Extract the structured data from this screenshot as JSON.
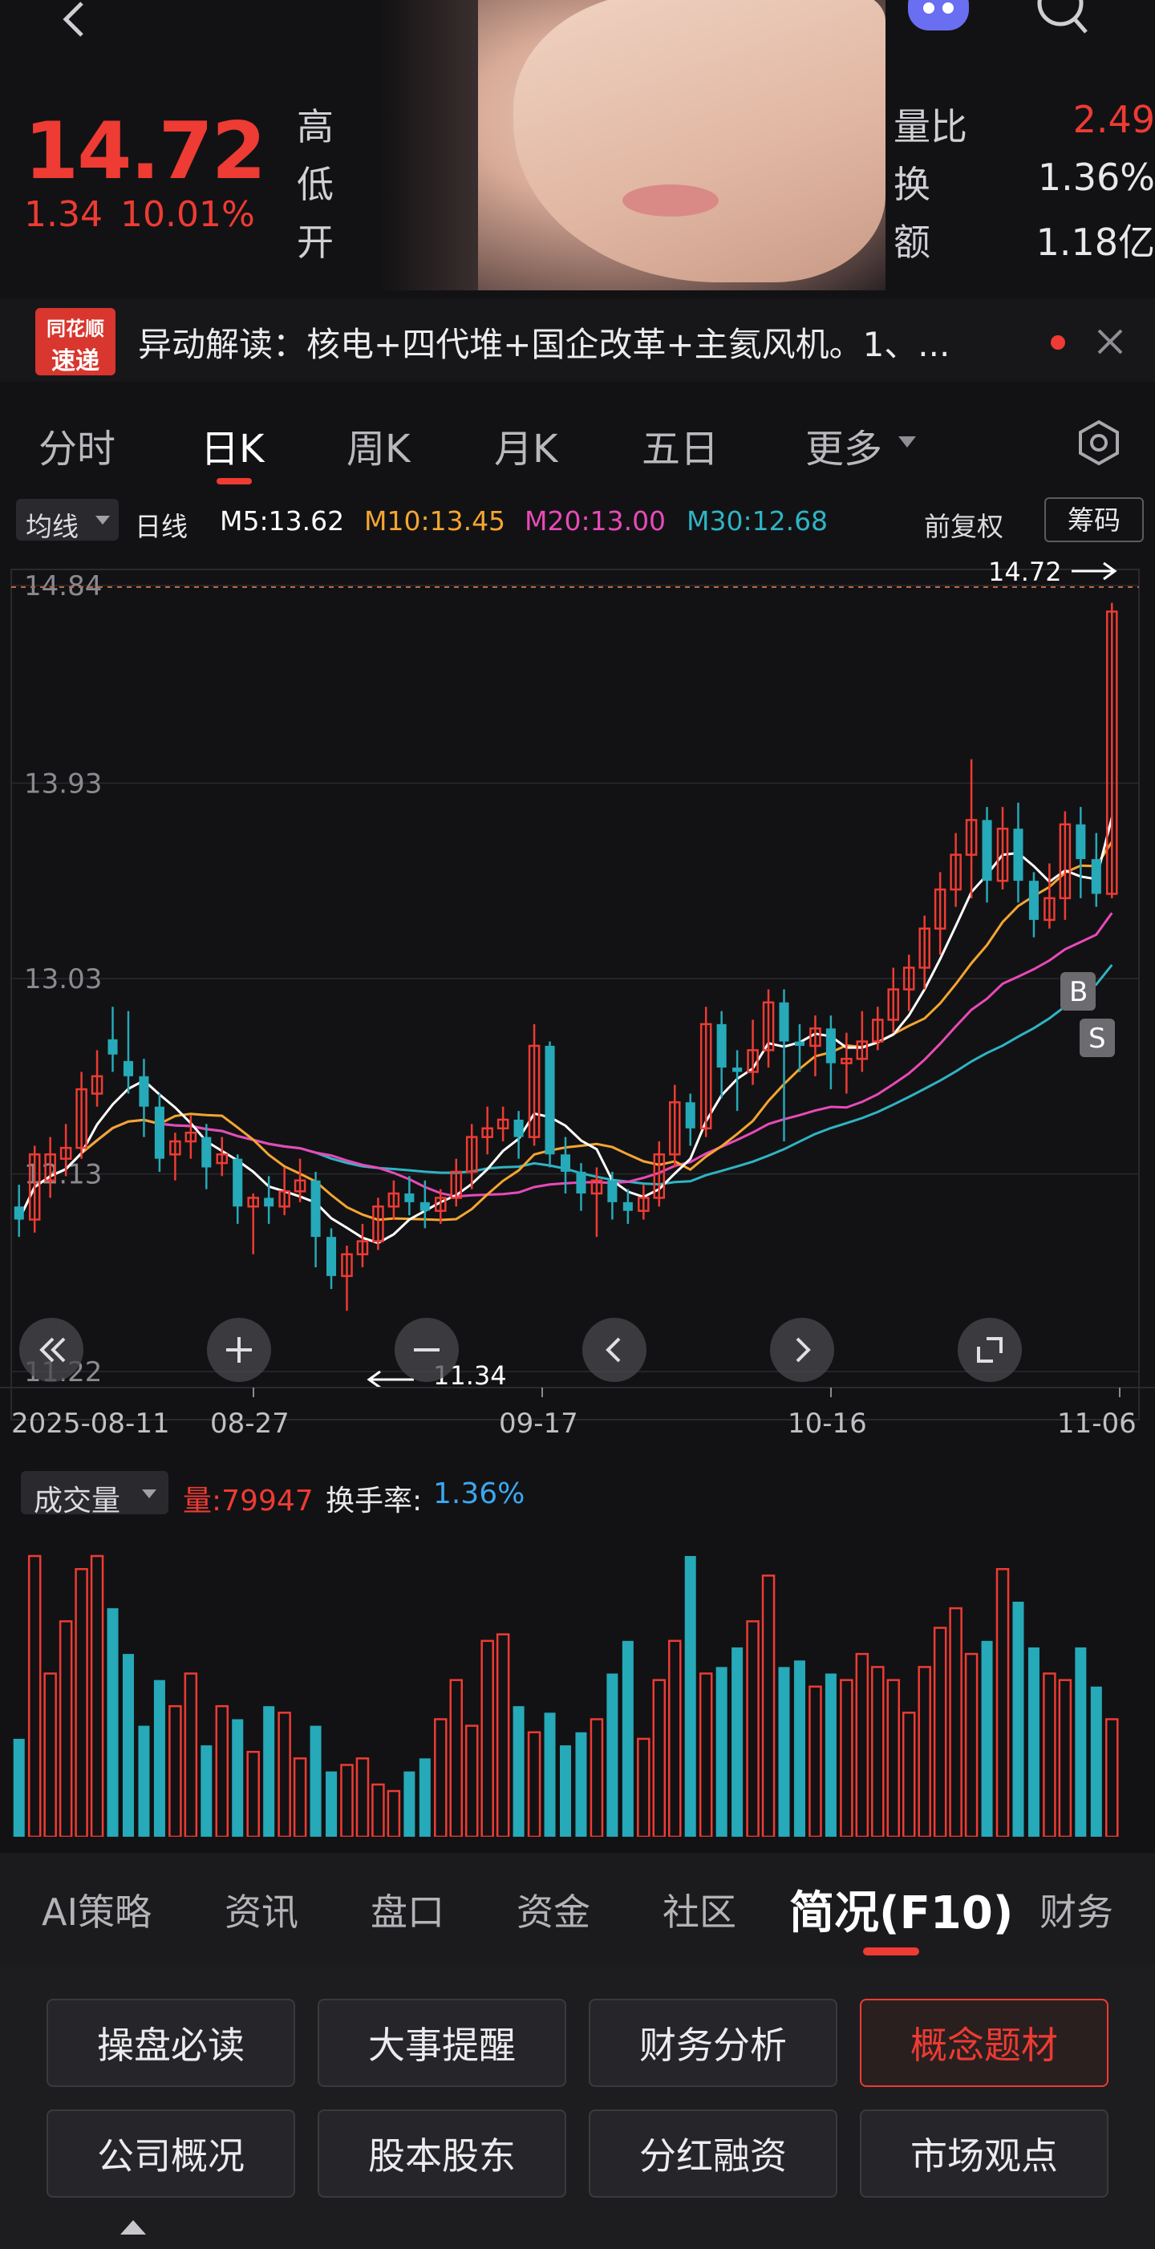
{
  "quote": {
    "price": "14.72",
    "change": "1.34",
    "change_pct": "10.01%",
    "label_high": "高",
    "label_low": "低",
    "label_open": "开",
    "label_volratio": "量比",
    "volratio": "2.49",
    "label_turnover": "换",
    "turnover": "1.36%",
    "label_amount": "额",
    "amount": "1.18亿"
  },
  "banner": {
    "logo_top": "同花顺",
    "logo_bottom": "速递",
    "text": "异动解读：核电+四代堆+国企改革+主氦风机。1、..."
  },
  "tabs": [
    "分时",
    "日K",
    "周K",
    "月K",
    "五日",
    "更多"
  ],
  "active_tab": "日K",
  "legend": {
    "ma_dropdown": "均线",
    "period": "日线",
    "m5": "M5:13.62",
    "m10": "M10:13.45",
    "m20": "M20:13.00",
    "m30": "M30:12.68",
    "adjust": "前复权",
    "chips": "筹码"
  },
  "colors": {
    "up": "#ee3b33",
    "down": "#26a9b8",
    "m5": "#ffffff",
    "m10": "#f4a531",
    "m20": "#e84ab8",
    "m30": "#2fb4c4"
  },
  "chart_data": {
    "type": "candlestick",
    "ylim": [
      11.22,
      14.84
    ],
    "y_ticks": [
      "14.84",
      "13.93",
      "13.03",
      "12.13",
      "11.22"
    ],
    "x_ticks": [
      "2025-08-11",
      "08-27",
      "09-17",
      "10-16",
      "11-06"
    ],
    "last_price_label": "14.72",
    "low_label": "11.34",
    "markers": [
      "B",
      "S"
    ],
    "candles": [
      [
        11.98,
        11.92,
        12.08,
        11.84
      ],
      [
        11.92,
        12.22,
        12.26,
        11.86
      ],
      [
        12.1,
        12.22,
        12.3,
        12.02
      ],
      [
        12.2,
        12.25,
        12.36,
        12.12
      ],
      [
        12.25,
        12.52,
        12.6,
        12.2
      ],
      [
        12.5,
        12.58,
        12.7,
        12.44
      ],
      [
        12.75,
        12.68,
        12.9,
        12.6
      ],
      [
        12.65,
        12.58,
        12.88,
        12.5
      ],
      [
        12.58,
        12.44,
        12.66,
        12.3
      ],
      [
        12.44,
        12.2,
        12.5,
        12.14
      ],
      [
        12.22,
        12.28,
        12.32,
        12.1
      ],
      [
        12.28,
        12.32,
        12.4,
        12.2
      ],
      [
        12.3,
        12.16,
        12.36,
        12.06
      ],
      [
        12.18,
        12.22,
        12.3,
        12.12
      ],
      [
        12.2,
        11.98,
        12.22,
        11.9
      ],
      [
        11.98,
        12.02,
        12.04,
        11.76
      ],
      [
        12.02,
        11.98,
        12.12,
        11.9
      ],
      [
        11.98,
        12.05,
        12.16,
        11.94
      ],
      [
        12.05,
        12.1,
        12.2,
        12.0
      ],
      [
        12.1,
        11.84,
        12.14,
        11.7
      ],
      [
        11.84,
        11.66,
        11.88,
        11.6
      ],
      [
        11.66,
        11.76,
        11.8,
        11.5
      ],
      [
        11.76,
        11.82,
        11.9,
        11.7
      ],
      [
        11.82,
        11.98,
        12.02,
        11.78
      ],
      [
        11.98,
        12.04,
        12.1,
        11.92
      ],
      [
        12.04,
        12.0,
        12.12,
        11.94
      ],
      [
        12.0,
        11.96,
        12.1,
        11.88
      ],
      [
        11.96,
        12.02,
        12.06,
        11.9
      ],
      [
        12.02,
        12.14,
        12.2,
        11.98
      ],
      [
        12.14,
        12.3,
        12.36,
        12.06
      ],
      [
        12.3,
        12.34,
        12.44,
        12.22
      ],
      [
        12.34,
        12.38,
        12.44,
        12.28
      ],
      [
        12.38,
        12.3,
        12.42,
        12.2
      ],
      [
        12.3,
        12.72,
        12.82,
        12.26
      ],
      [
        12.72,
        12.22,
        12.74,
        12.16
      ],
      [
        12.22,
        12.14,
        12.3,
        12.04
      ],
      [
        12.14,
        12.04,
        12.18,
        11.96
      ],
      [
        12.04,
        12.1,
        12.16,
        11.84
      ],
      [
        12.1,
        12.0,
        12.14,
        11.92
      ],
      [
        12.0,
        11.96,
        12.06,
        11.9
      ],
      [
        11.96,
        12.02,
        12.08,
        11.92
      ],
      [
        12.02,
        12.22,
        12.28,
        11.98
      ],
      [
        12.22,
        12.46,
        12.54,
        12.16
      ],
      [
        12.46,
        12.34,
        12.5,
        12.26
      ],
      [
        12.34,
        12.82,
        12.9,
        12.3
      ],
      [
        12.82,
        12.62,
        12.88,
        12.48
      ],
      [
        12.62,
        12.6,
        12.7,
        12.42
      ],
      [
        12.6,
        12.7,
        12.84,
        12.54
      ],
      [
        12.7,
        12.92,
        12.98,
        12.62
      ],
      [
        12.92,
        12.74,
        12.98,
        12.28
      ],
      [
        12.74,
        12.72,
        12.82,
        12.6
      ],
      [
        12.72,
        12.8,
        12.86,
        12.58
      ],
      [
        12.8,
        12.64,
        12.86,
        12.52
      ],
      [
        12.64,
        12.66,
        12.78,
        12.5
      ],
      [
        12.66,
        12.74,
        12.88,
        12.6
      ],
      [
        12.74,
        12.84,
        12.9,
        12.7
      ],
      [
        12.84,
        12.98,
        13.08,
        12.78
      ],
      [
        12.98,
        13.08,
        13.14,
        12.88
      ],
      [
        13.08,
        13.26,
        13.32,
        12.98
      ],
      [
        13.26,
        13.44,
        13.52,
        13.14
      ],
      [
        13.44,
        13.6,
        13.7,
        13.36
      ],
      [
        13.6,
        13.76,
        14.04,
        13.4
      ],
      [
        13.76,
        13.48,
        13.82,
        13.38
      ],
      [
        13.48,
        13.72,
        13.82,
        13.44
      ],
      [
        13.72,
        13.48,
        13.84,
        13.38
      ],
      [
        13.48,
        13.3,
        13.52,
        13.22
      ],
      [
        13.3,
        13.4,
        13.56,
        13.26
      ],
      [
        13.4,
        13.74,
        13.8,
        13.3
      ],
      [
        13.74,
        13.58,
        13.82,
        13.4
      ],
      [
        13.58,
        13.42,
        13.7,
        13.36
      ],
      [
        13.42,
        14.72,
        14.76,
        13.4
      ]
    ],
    "volume": {
      "label": "成交量",
      "value_text": "量:79947",
      "turnover_label": "换手率:",
      "turnover_value": "1.36%",
      "values": [
        30,
        86,
        50,
        66,
        82,
        86,
        70,
        56,
        34,
        48,
        40,
        50,
        28,
        40,
        36,
        26,
        40,
        38,
        24,
        34,
        20,
        22,
        24,
        16,
        14,
        20,
        24,
        36,
        48,
        34,
        60,
        62,
        40,
        32,
        38,
        28,
        32,
        36,
        50,
        60,
        30,
        48,
        60,
        86,
        50,
        52,
        58,
        66,
        80,
        52,
        54,
        46,
        50,
        48,
        56,
        52,
        48,
        38,
        52,
        64,
        70,
        56,
        60,
        82,
        72,
        58,
        50,
        48,
        58,
        46,
        36
      ]
    }
  },
  "bottom_tabs": [
    "AI策略",
    "资讯",
    "盘口",
    "资金",
    "社区",
    "简况(F10)",
    "财务"
  ],
  "active_bottom_tab": "简况(F10)",
  "cards": [
    "操盘必读",
    "大事提醒",
    "财务分析",
    "概念题材",
    "公司概况",
    "股本股东",
    "分红融资",
    "市场观点"
  ],
  "selected_card": "概念题材"
}
